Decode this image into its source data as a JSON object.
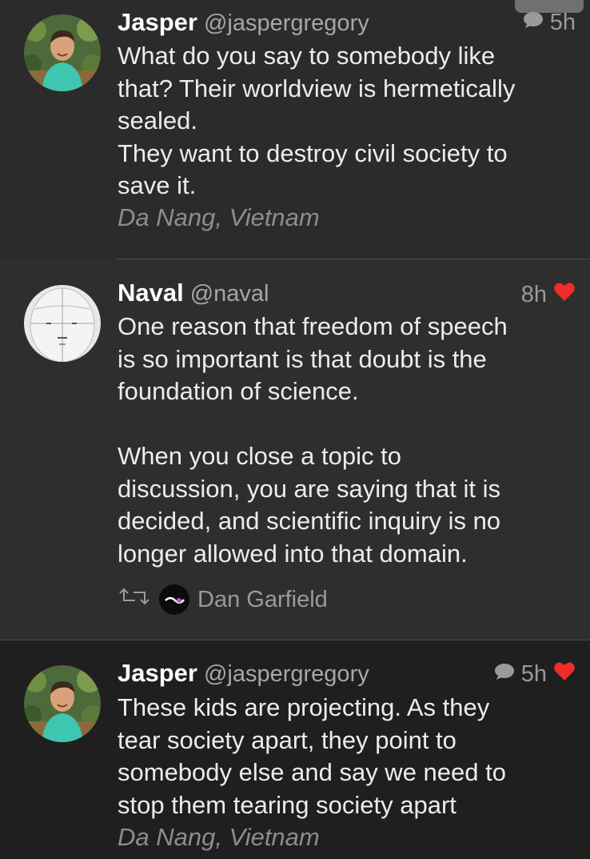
{
  "colors": {
    "background": "#2b2b2b",
    "like_red": "#ef2b2b",
    "name_white": "#ffffff",
    "muted_gray": "#9a9a9a"
  },
  "tweets": [
    {
      "name": "Jasper",
      "handle": "@jaspergregory",
      "time": "5h",
      "has_reply_icon": true,
      "liked": false,
      "text": "What do you say to somebody like\nthat? Their worldview is hermetically\nsealed.\nThey want to destroy civil society to\nsave it.",
      "location": "Da Nang, Vietnam"
    },
    {
      "name": "Naval",
      "handle": "@naval",
      "time": "8h",
      "has_reply_icon": false,
      "liked": true,
      "text": "One reason that freedom of speech\nis so important is that doubt is the\nfoundation of science.\n\nWhen you close a topic to\ndiscussion, you are saying that it is\ndecided, and scientific inquiry is no\nlonger allowed into that domain.",
      "retweeted_by": "Dan Garfield"
    },
    {
      "name": "Jasper",
      "handle": "@jaspergregory",
      "time": "5h",
      "has_reply_icon": true,
      "liked": true,
      "text": "These kids are projecting. As they\ntear society apart, they point to\nsomebody else and say we need to\nstop them tearing society apart",
      "location": "Da Nang, Vietnam"
    }
  ],
  "icons": {
    "reply": "speech-bubble-icon",
    "like": "heart-icon",
    "retweet": "retweet-icon"
  }
}
